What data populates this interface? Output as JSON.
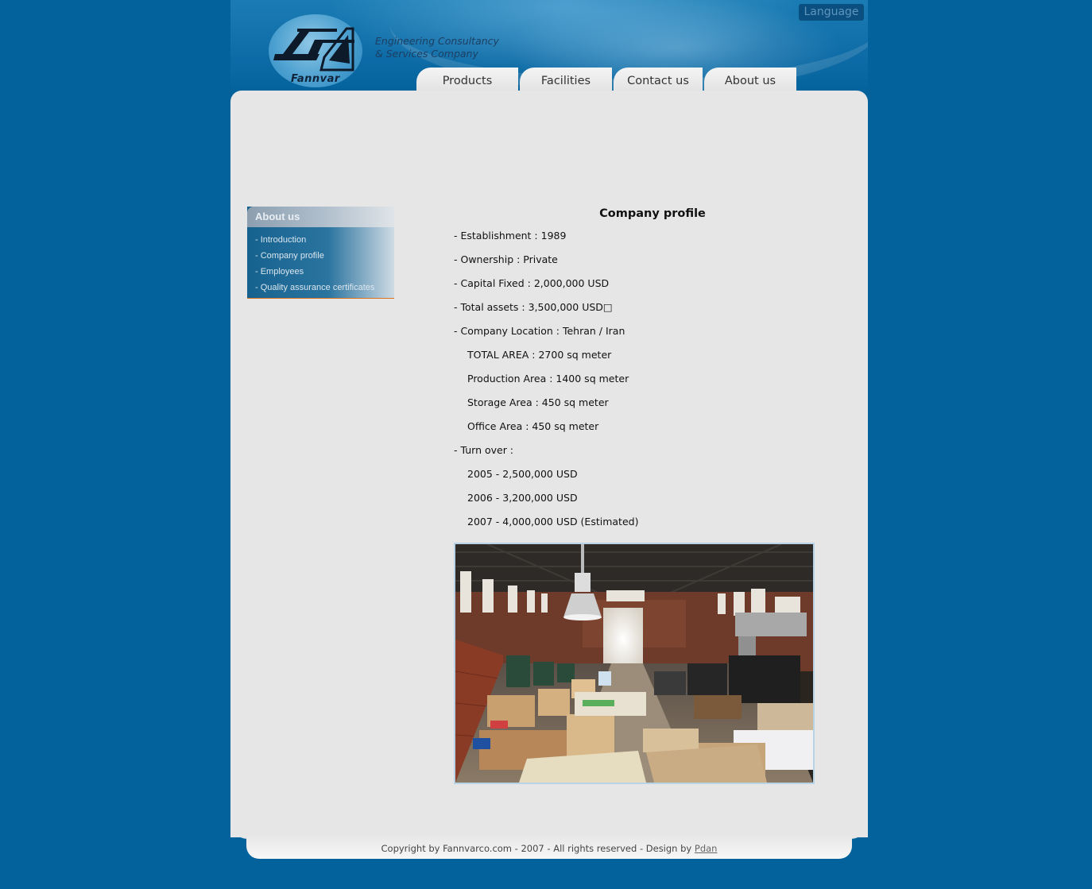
{
  "header": {
    "logo_name": "Fannvar",
    "tagline_line1": "Engineering  Consultancy",
    "tagline_line2": "& Services Company",
    "language_label": "Language"
  },
  "tabs": [
    {
      "label": "Products"
    },
    {
      "label": "Facilities"
    },
    {
      "label": "Contact us"
    },
    {
      "label": "About us"
    }
  ],
  "sidebar": {
    "title": "About us",
    "items": [
      {
        "label": "- Introduction"
      },
      {
        "label": "- Company profile"
      },
      {
        "label": "- Employees"
      },
      {
        "label": "- Quality assurance certificates"
      }
    ]
  },
  "content": {
    "title": "Company profile",
    "lines": [
      "- Establishment : 1989",
      "- Ownership : Private",
      "- Capital Fixed : 2,000,000 USD",
      "- Total assets : 3,500,000 USD□",
      "- Company Location : Tehran / Iran",
      "TOTAL AREA : 2700 sq meter",
      "Production Area : 1400 sq meter",
      "Storage Area : 450 sq meter",
      "Office Area : 450 sq meter",
      "- Turn over :",
      "2005 - 2,500,000 USD",
      "2006 - 3,200,000 USD",
      "2007 - 4,000,000 USD (Estimated)"
    ]
  },
  "footer": {
    "copyright": "Copyright by Fannvarco.com - 2007 - All rights reserved - Design by ",
    "designer_link": "Pdan"
  },
  "colors": {
    "page_background": "#03629b",
    "panel_background": "#e6e6e6",
    "sidebar_accent": "#d9731e"
  }
}
